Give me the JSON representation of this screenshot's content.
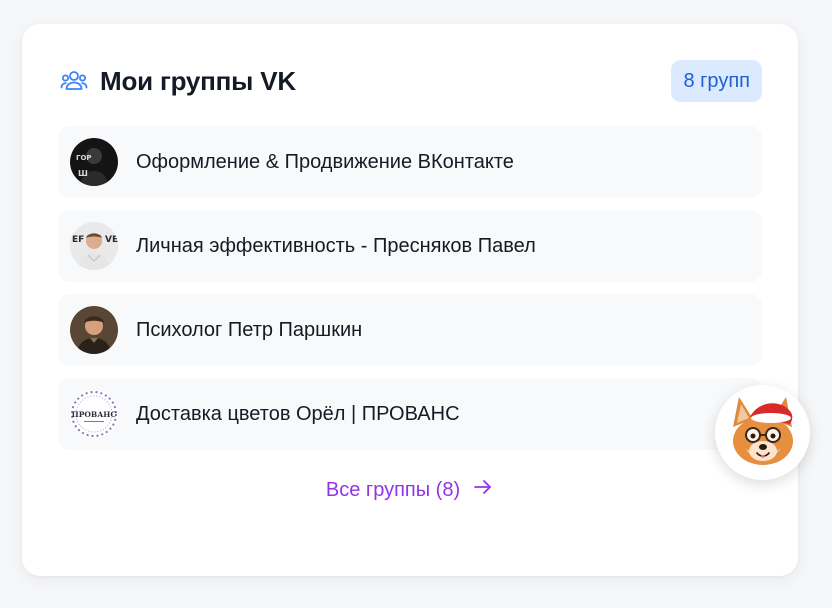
{
  "widget": {
    "title": "Мои группы VK",
    "count_badge": "8 групп",
    "title_icon": "users-icon",
    "accent_color": "#3b82f6"
  },
  "groups": [
    {
      "name": "Оформление & Продвижение ВКонтакте",
      "avatar": "dark-portrait-avatar"
    },
    {
      "name": "Личная эффективность - Пресняков Павел",
      "avatar": "man-portrait-avatar"
    },
    {
      "name": "Психолог Петр Паршкин",
      "avatar": "man-portrait-avatar"
    },
    {
      "name": "Доставка цветов Орёл | ПРОВАНС",
      "avatar": "provance-logo-avatar"
    }
  ],
  "avatar_text": {
    "provance": "ПРОВАНС"
  },
  "footer": {
    "all_groups_label": "Все группы (8)",
    "link_color": "#9333ea",
    "arrow_icon": "arrow-right-icon"
  },
  "mascot": {
    "icon": "corgi-santa-mascot-icon"
  }
}
